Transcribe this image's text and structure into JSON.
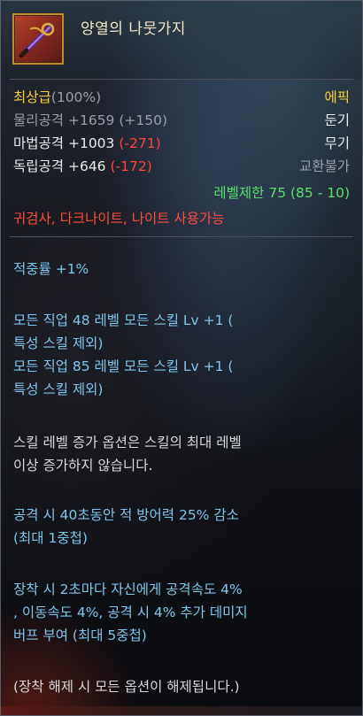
{
  "item": {
    "name": "양열의 나뭇가지",
    "grade": "최상급",
    "grade_pct": "(100%)",
    "rarity": "에픽",
    "category": "둔기",
    "type": "무기",
    "trade": "교환불가"
  },
  "stats": {
    "phys_label": "물리공격 +1659",
    "phys_bonus": "(+150)",
    "mag_label": "마법공격 +1003",
    "mag_bonus": "(-271)",
    "ind_label": "독립공격 +646",
    "ind_bonus": "(-172)"
  },
  "level_req": "레벨제한 75 (85 - 10)",
  "classes": "귀검사, 다크나이트, 나이트 사용가능",
  "options": {
    "hit_rate": "적중률 +1%",
    "skill_48_line1": "모든 직업 48 레벨 모든 스킬 Lv +1 (",
    "skill_48_line2": "특성 스킬 제외)",
    "skill_85_line1": "모든 직업 85 레벨 모든 스킬 Lv +1 (",
    "skill_85_line2": "특성 스킬 제외)",
    "note_line1": "스킬 레벨 증가 옵션은 스킬의 최대 레벨",
    "note_line2": "이상 증가하지 않습니다.",
    "def_line1": "공격 시 40초동안 적 방어력 25% 감소",
    "def_line2": "(최대 1중첩)",
    "buff_line1": "장착 시 2초마다 자신에게 공격속도 4%",
    "buff_line2": ", 이동속도 4%, 공격 시 4% 추가 데미지",
    "buff_line3": "버프 부여 (최대 5중첩)",
    "unequip_note": "(장착 해제 시 모든 옵션이 해제됩니다.)"
  },
  "colors": {
    "grade": "#f5cf3a",
    "rarity": "#f5cf3a",
    "negative": "#ff4438",
    "level_req": "#56e06e",
    "classes": "#ff4c3c",
    "option_text": "#7ec6ee"
  },
  "icons": {
    "item_icon": "weapon-icon"
  }
}
